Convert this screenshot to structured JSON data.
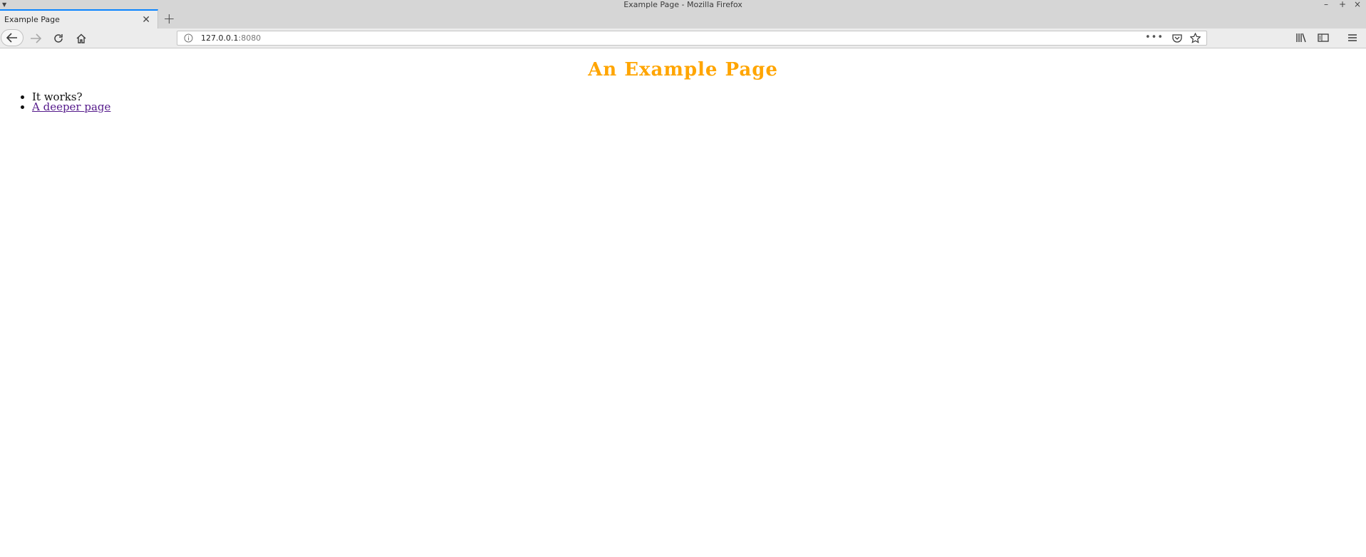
{
  "window": {
    "title": "Example Page - Mozilla Firefox",
    "controls": [
      "–",
      "+",
      "×"
    ]
  },
  "tabs": [
    {
      "label": "Example Page",
      "active": true
    }
  ],
  "urlbar": {
    "host": "127.0.0.1",
    "port": ":8080",
    "overflow": "•••"
  },
  "page": {
    "heading": "An Example Page",
    "heading_color": "#ffa500",
    "items": [
      {
        "text": "It works?",
        "link": false
      },
      {
        "text": "A deeper page",
        "link": true
      }
    ]
  },
  "colors": {
    "accent": "#0a84ff",
    "link_visited": "#551a8b"
  },
  "icons": [
    "window-menu-icon",
    "close-tab-icon",
    "new-tab-icon",
    "back-icon",
    "forward-icon",
    "reload-icon",
    "home-icon",
    "info-icon",
    "pocket-icon",
    "bookmark-star-icon",
    "library-icon",
    "sidebar-icon",
    "hamburger-menu-icon"
  ]
}
